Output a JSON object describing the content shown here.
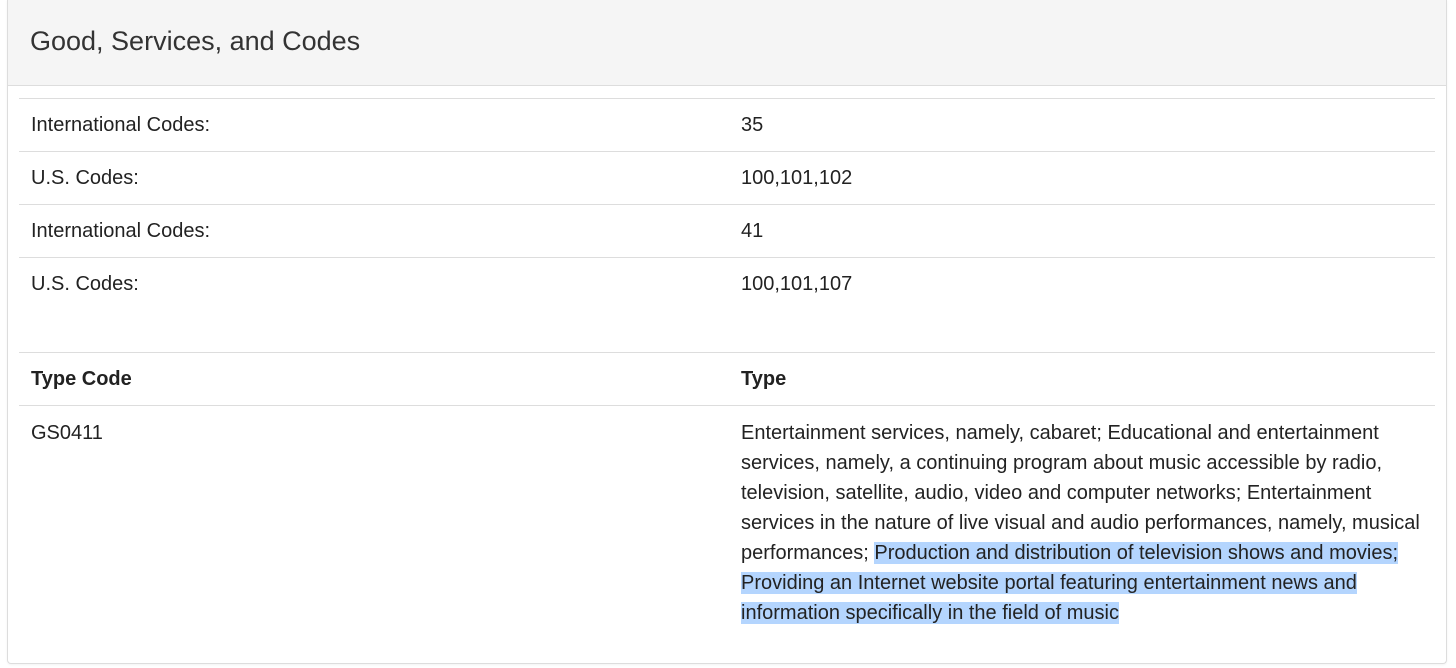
{
  "panel": {
    "title": "Good, Services, and Codes"
  },
  "codes": [
    {
      "label": "International Codes:",
      "value": "35"
    },
    {
      "label": "U.S. Codes:",
      "value": "100,101,102"
    },
    {
      "label": "International Codes:",
      "value": "41"
    },
    {
      "label": "U.S. Codes:",
      "value": "100,101,107"
    }
  ],
  "type_table": {
    "headers": {
      "type_code": "Type Code",
      "type": "Type"
    },
    "rows": [
      {
        "type_code": "GS0411",
        "type_text_plain": "Entertainment services, namely, cabaret; Educational and entertainment services, namely, a continuing program about music accessible by radio, television, satellite, audio, video and computer networks; Entertainment services in the nature of live visual and audio performances, namely, musical performances; ",
        "type_text_selected": "Production and distribution of television shows and movies; Providing an Internet website portal featuring entertainment news and information specifically in the field of music"
      }
    ]
  },
  "colors": {
    "heading_bg": "#f5f5f5",
    "border": "#dddddd",
    "selection": "#b4d5fe"
  }
}
